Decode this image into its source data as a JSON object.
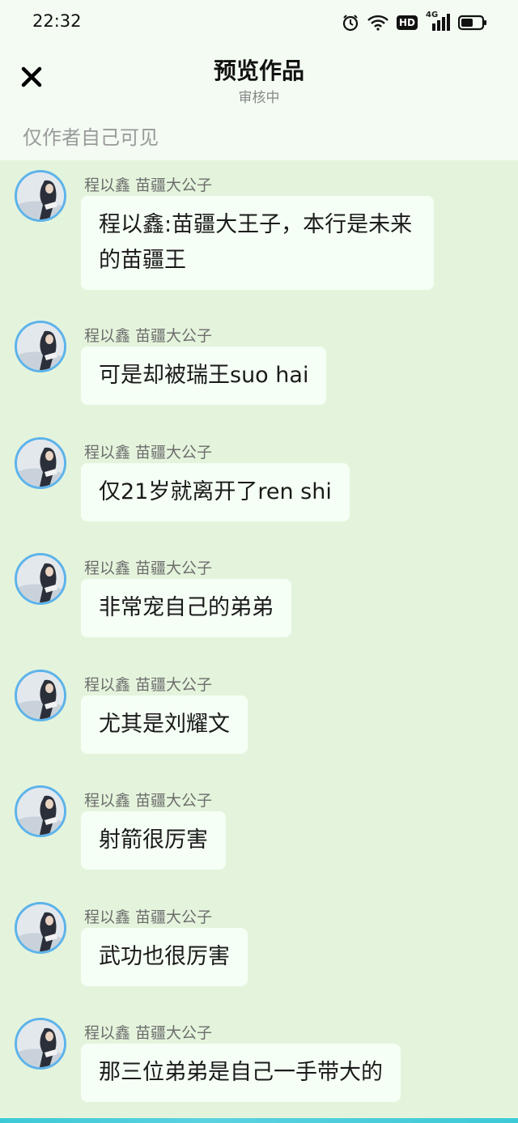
{
  "status_bar": {
    "time": "22:32",
    "icons": [
      "alarm-icon",
      "wifi-icon",
      "hd-badge",
      "signal-4g-icon",
      "battery-icon"
    ],
    "hd_label": "HD",
    "net_label": "4G"
  },
  "header": {
    "title": "预览作品",
    "subtitle": "审核中",
    "close_icon": "close-icon"
  },
  "visibility_note": "仅作者自己可见",
  "messages": [
    {
      "sender": "程以鑫 苗疆大公子",
      "text": "程以鑫:苗疆大王子，本行是未来的苗疆王"
    },
    {
      "sender": "程以鑫 苗疆大公子",
      "text": "可是却被瑞王suo hai"
    },
    {
      "sender": "程以鑫 苗疆大公子",
      "text": "仅21岁就离开了ren shi"
    },
    {
      "sender": "程以鑫 苗疆大公子",
      "text": "非常宠自己的弟弟"
    },
    {
      "sender": "程以鑫 苗疆大公子",
      "text": "尤其是刘耀文"
    },
    {
      "sender": "程以鑫 苗疆大公子",
      "text": "射箭很厉害"
    },
    {
      "sender": "程以鑫 苗疆大公子",
      "text": "武功也很厉害"
    },
    {
      "sender": "程以鑫 苗疆大公子",
      "text": "那三位弟弟是自己一手带大的"
    }
  ],
  "colors": {
    "chat_background": "#e4f4dc",
    "bubble": "#f5fff5",
    "avatar_ring": "#5db3ea",
    "bottom_accent": "#3cc9d6"
  }
}
